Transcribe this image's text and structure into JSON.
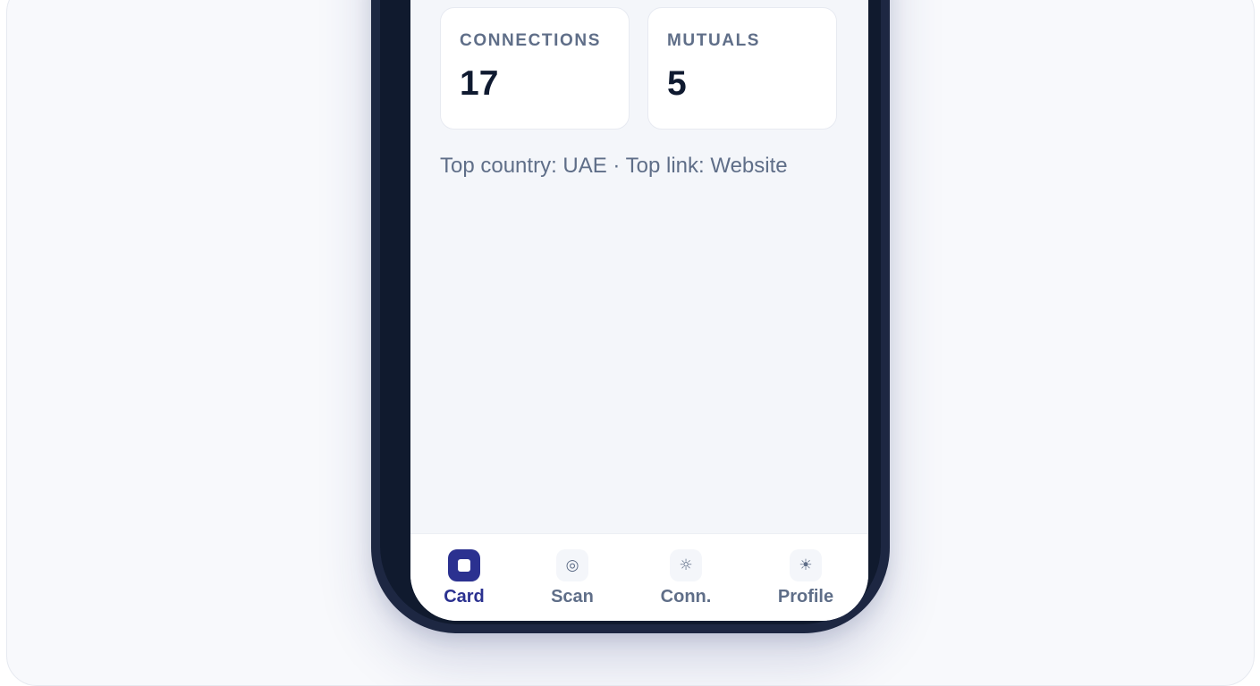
{
  "stats": {
    "connections": {
      "label": "CONNECTIONS",
      "value": "17"
    },
    "mutuals": {
      "label": "MUTUALS",
      "value": "5"
    }
  },
  "insight": "Top country: UAE · Top link: Website",
  "tabs": [
    {
      "label": "Card",
      "icon": "card-icon",
      "active": true
    },
    {
      "label": "Scan",
      "icon": "scan-icon",
      "glyph": "◎",
      "active": false
    },
    {
      "label": "Conn.",
      "icon": "connections-icon",
      "glyph": "☼",
      "active": false
    },
    {
      "label": "Profile",
      "icon": "profile-icon",
      "glyph": "☀",
      "active": false
    }
  ],
  "colors": {
    "accent": "#2b3190",
    "muted_text": "#5f6e88",
    "dark_text": "#0f1a30",
    "phone_frame": "#101a2e",
    "screen_bg": "#f4f6fa"
  }
}
